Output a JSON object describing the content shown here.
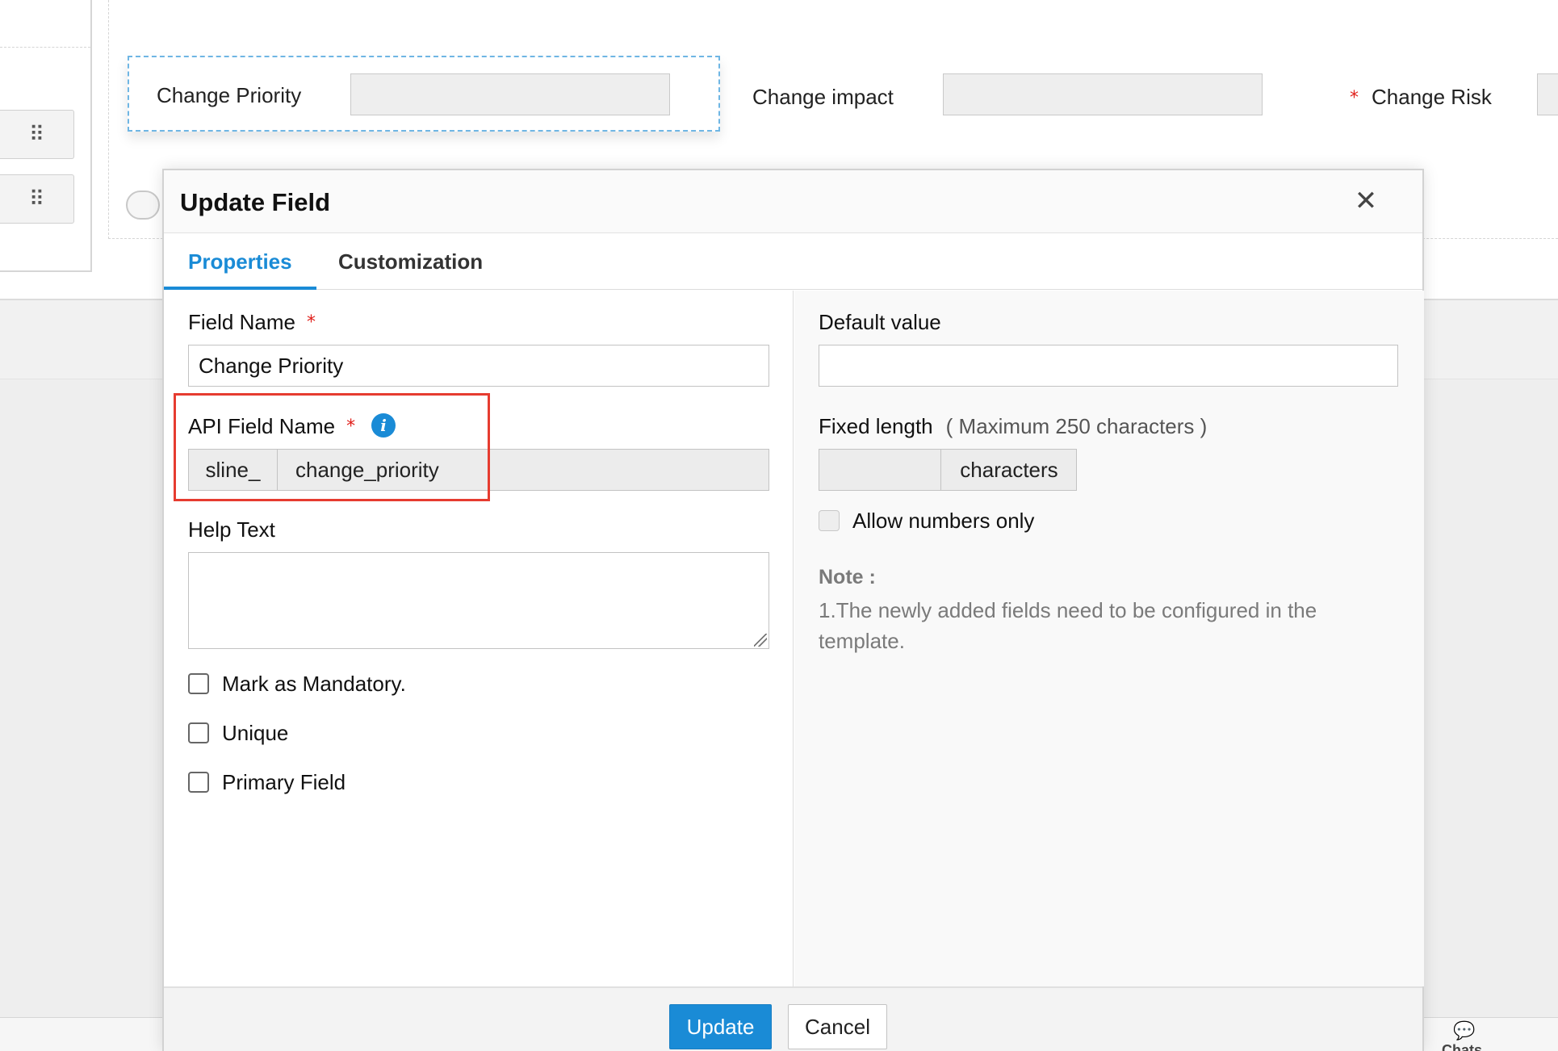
{
  "background": {
    "fields": [
      {
        "label": "Change Priority",
        "required": false
      },
      {
        "label": "Change impact",
        "required": false
      },
      {
        "label": "Change Risk",
        "required": true
      }
    ],
    "chats_label": "Chats"
  },
  "modal": {
    "title": "Update Field",
    "close_icon": "close-icon",
    "tabs": [
      {
        "label": "Properties",
        "active": true
      },
      {
        "label": "Customization",
        "active": false
      }
    ],
    "left": {
      "field_name": {
        "label": "Field Name",
        "required_mark": "*",
        "value": "Change Priority"
      },
      "api_field_name": {
        "label": "API Field Name",
        "required_mark": "*",
        "info_icon": "i",
        "prefix": "sline_",
        "value": "change_priority"
      },
      "help_text": {
        "label": "Help Text",
        "value": ""
      },
      "checkboxes": [
        {
          "label": "Mark as Mandatory.",
          "checked": false
        },
        {
          "label": "Unique",
          "checked": false
        },
        {
          "label": "Primary Field",
          "checked": false
        }
      ]
    },
    "right": {
      "default_value": {
        "label": "Default value",
        "value": ""
      },
      "fixed_length": {
        "label": "Fixed length",
        "hint": "( Maximum 250 characters )",
        "value": "",
        "suffix": "characters"
      },
      "allow_numbers": {
        "label": "Allow numbers only",
        "checked": false
      },
      "note": {
        "title": "Note :",
        "text": "1.The newly added fields need to be configured in the template."
      }
    },
    "footer": {
      "update_label": "Update",
      "cancel_label": "Cancel"
    }
  },
  "colors": {
    "accent": "#1a8bd6",
    "required": "#e0201b",
    "highlight_border": "#e63c30"
  }
}
